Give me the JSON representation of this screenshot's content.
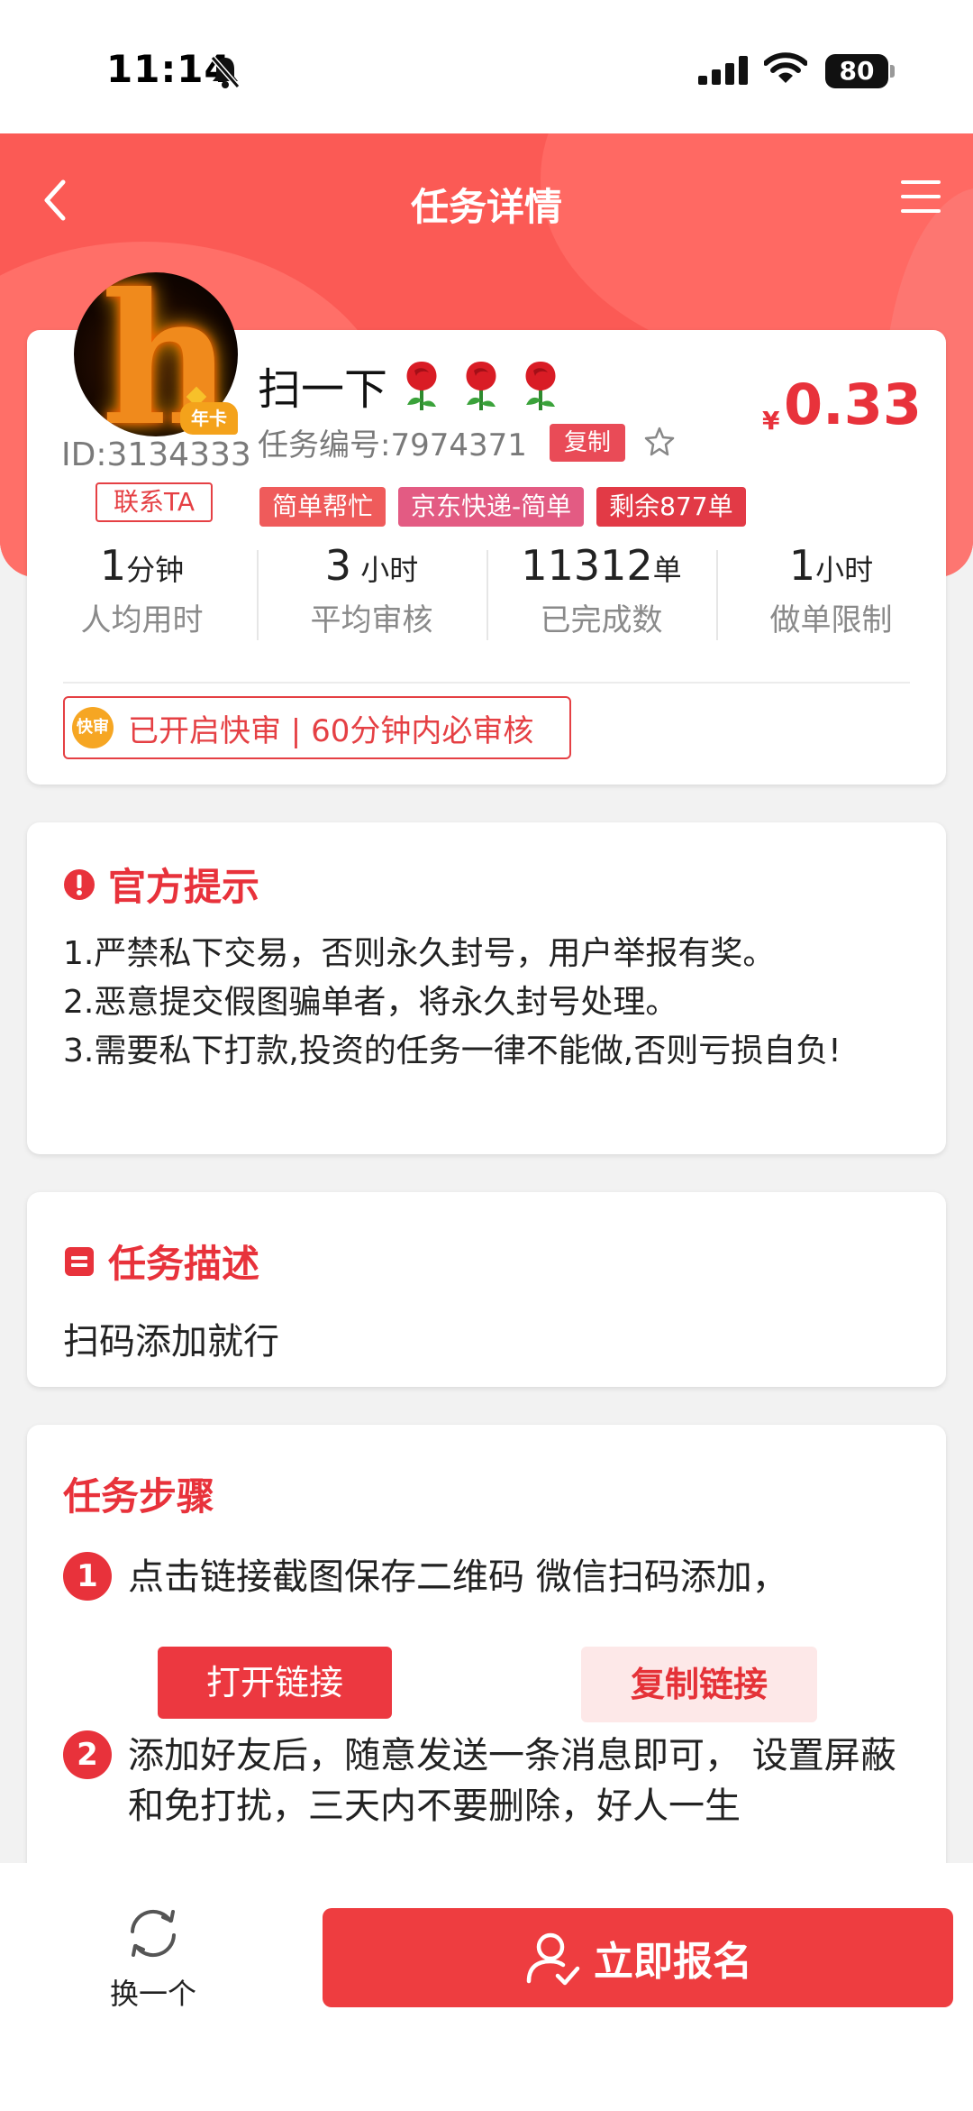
{
  "status_bar": {
    "time": "11:14",
    "battery": "80"
  },
  "nav": {
    "title": "任务详情"
  },
  "poster": {
    "id_text": "ID:3134333",
    "contact_label": "联系TA",
    "badge": "年卡"
  },
  "task": {
    "title": "扫一下",
    "price_symbol": "¥",
    "price": "0.33",
    "number_text": "任务编号:7974371",
    "copy_label": "复制",
    "tags": [
      "简单帮忙",
      "京东快递-简单",
      "剩余877单"
    ]
  },
  "stats": [
    {
      "value": "1",
      "unit": "分钟",
      "label": "人均用时"
    },
    {
      "value": "3",
      "unit": " 小时",
      "label": "平均审核"
    },
    {
      "value": "11312",
      "unit": "单",
      "label": "已完成数"
    },
    {
      "value": "1",
      "unit": "小时",
      "label": "做单限制"
    }
  ],
  "fast_review": {
    "icon_text": "快审",
    "text": "已开启快审 | 60分钟内必审核"
  },
  "notice": {
    "title": "官方提示",
    "lines": [
      "1.严禁私下交易，否则永久封号，用户举报有奖。",
      "2.恶意提交假图骗单者，将永久封号处理。",
      "3.需要私下打款,投资的任务一律不能做,否则亏损自负!"
    ]
  },
  "description": {
    "title": "任务描述",
    "text": "扫码添加就行"
  },
  "steps": {
    "title": "任务步骤",
    "items": [
      {
        "num": "1",
        "text": "点击链接截图保存二维码 微信扫码添加，"
      },
      {
        "num": "2",
        "text": "添加好友后，随意发送一条消息即可， 设置屏蔽和免打扰，三天内不要删除，好人一生"
      }
    ],
    "open_link_label": "打开链接",
    "copy_link_label": "复制链接"
  },
  "bottom": {
    "swap_label": "换一个",
    "signup_label": "立即报名"
  },
  "colors": {
    "primary_red": "#e8323b",
    "hero_red": "#fb5a55"
  }
}
